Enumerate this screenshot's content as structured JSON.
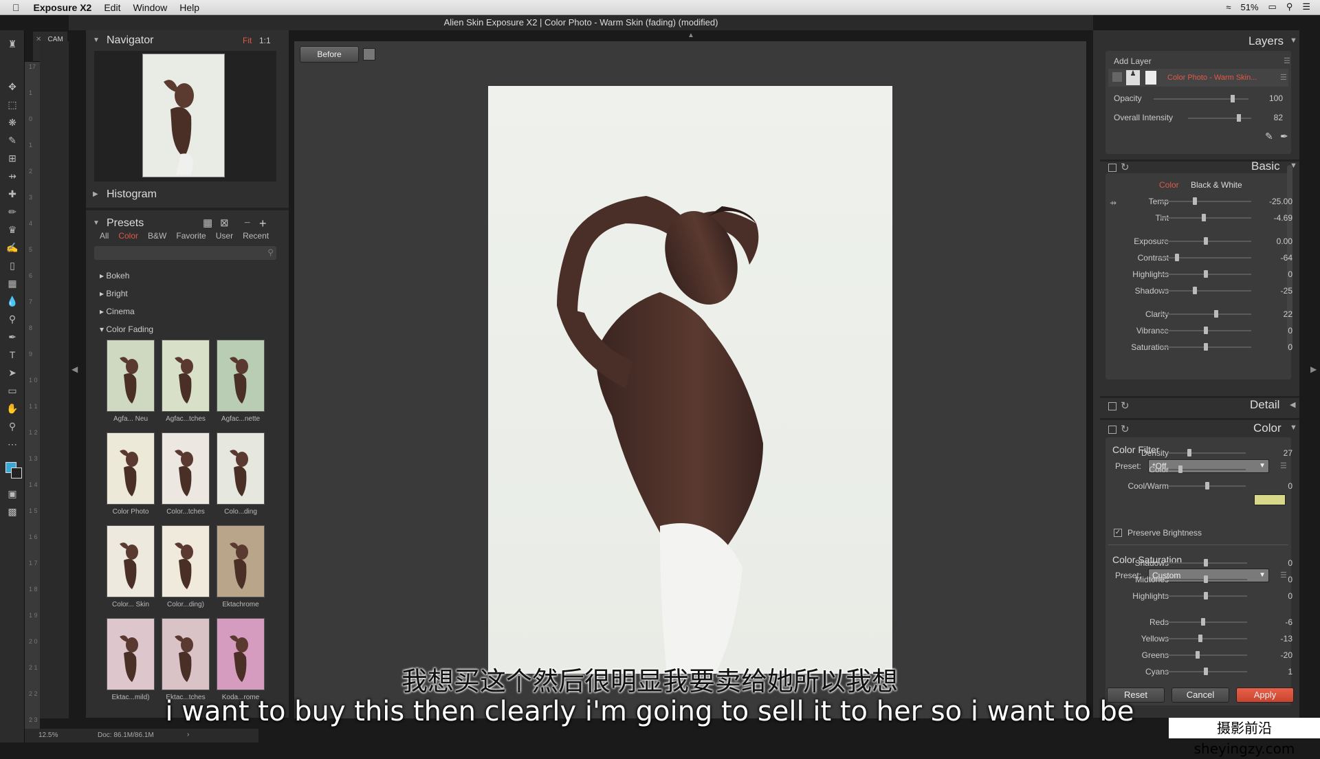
{
  "menubar": {
    "app": "Exposure X2",
    "items": [
      "Edit",
      "Window",
      "Help"
    ],
    "battery": "51%"
  },
  "window": {
    "title": "Alien Skin Exposure X2 | Color Photo - Warm Skin (fading) (modified)"
  },
  "ruler": {
    "zoom": "50",
    "ticks": [
      "17",
      "1",
      "0",
      "1",
      "2",
      "3",
      "4",
      "5",
      "6",
      "7",
      "8",
      "9",
      "1 0",
      "1 1",
      "1 2",
      "1 3",
      "1 4",
      "1 5",
      "1 6",
      "1 7",
      "1 8",
      "1 9",
      "2 0",
      "2 1",
      "2 2",
      "2 3"
    ],
    "tab": "_CAM"
  },
  "navigator": {
    "title": "Navigator",
    "fit": "Fit",
    "one_to_one": "1:1"
  },
  "histogram": {
    "title": "Histogram"
  },
  "presets": {
    "title": "Presets",
    "tabs": [
      "All",
      "Color",
      "B&W",
      "Favorite",
      "User",
      "Recent"
    ],
    "categories": [
      "Bokeh",
      "Bright",
      "Cinema",
      "Color Fading"
    ],
    "thumbs": [
      {
        "label": "Agfa... Neu",
        "color": "#cfd8c0"
      },
      {
        "label": "Agfac...tches",
        "color": "#d8e0c8"
      },
      {
        "label": "Agfac...nette",
        "color": "#b9ccb4"
      },
      {
        "label": "Color Photo",
        "color": "#ece9d8"
      },
      {
        "label": "Color...tches",
        "color": "#ece7e0"
      },
      {
        "label": "Colo...ding",
        "color": "#e6e8e0"
      },
      {
        "label": "Color... Skin",
        "color": "#eee9df"
      },
      {
        "label": "Color...ding)",
        "color": "#f0eadc"
      },
      {
        "label": "Ektachrome",
        "color": "#b9a58a"
      },
      {
        "label": "Ektac...mild)",
        "color": "#ddc6cc"
      },
      {
        "label": "Ektac...tches",
        "color": "#d9c3c6"
      },
      {
        "label": "Koda...rome",
        "color": "#d59cc0"
      }
    ]
  },
  "toolbar": {
    "before_label": "Before"
  },
  "layers": {
    "title": "Layers",
    "add_layer": "Add Layer",
    "layer_name": "Color Photo - Warm Skin...",
    "opacity_label": "Opacity",
    "opacity_value": "100",
    "opacity_frac": 0.85,
    "intensity_label": "Overall Intensity",
    "intensity_value": "82",
    "intensity_frac": 0.82
  },
  "basic": {
    "title": "Basic",
    "mode_color": "Color",
    "mode_bw": "Black & White",
    "sliders": [
      {
        "label": "Temp",
        "value": "-25.00",
        "frac": 0.38
      },
      {
        "label": "Tint",
        "value": "-4.69",
        "frac": 0.48
      },
      {
        "label": "Exposure",
        "value": "0.00",
        "frac": 0.5
      },
      {
        "label": "Contrast",
        "value": "-64",
        "frac": 0.18
      },
      {
        "label": "Highlights",
        "value": "0",
        "frac": 0.5
      },
      {
        "label": "Shadows",
        "value": "-25",
        "frac": 0.38
      },
      {
        "label": "Clarity",
        "value": "22",
        "frac": 0.61
      },
      {
        "label": "Vibrance",
        "value": "0",
        "frac": 0.5
      },
      {
        "label": "Saturation",
        "value": "0",
        "frac": 0.5
      }
    ]
  },
  "detail": {
    "title": "Detail"
  },
  "color": {
    "title": "Color",
    "filter_title": "Color Filter",
    "preset_label": "Preset:",
    "filter_preset": "*Off",
    "filter_sliders": [
      {
        "label": "Density",
        "value": "27",
        "frac": 0.27
      },
      {
        "label": "Color",
        "value": "",
        "frac": 0.15
      },
      {
        "label": "Cool/Warm",
        "value": "0",
        "frac": 0.5
      }
    ],
    "swatch": "#d8d88a",
    "preserve": "Preserve Brightness",
    "saturation_title": "Color Saturation",
    "sat_preset": "Custom",
    "sat_sliders": [
      {
        "label": "Shadows",
        "value": "0",
        "frac": 0.5
      },
      {
        "label": "Midtones",
        "value": "0",
        "frac": 0.5
      },
      {
        "label": "Highlights",
        "value": "0",
        "frac": 0.5
      },
      {
        "label": "Reds",
        "value": "-6",
        "frac": 0.47
      },
      {
        "label": "Yellows",
        "value": "-13",
        "frac": 0.43
      },
      {
        "label": "Greens",
        "value": "-20",
        "frac": 0.4
      },
      {
        "label": "Cyans",
        "value": "1",
        "frac": 0.5
      }
    ]
  },
  "buttons": {
    "reset": "Reset",
    "cancel": "Cancel",
    "apply": "Apply"
  },
  "status": {
    "zoom": "12.5%",
    "doc": "Doc: 86.1M/86.1M"
  },
  "subtitles": {
    "cn": "我想买这个然后很明显我要卖给她所以我想",
    "en": "i want to buy this then clearly i'm going to sell it to her so i want to be"
  },
  "watermark": "摄影前沿 sheyingzy.com"
}
